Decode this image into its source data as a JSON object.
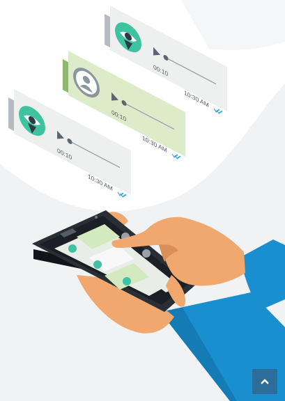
{
  "voice_messages": [
    {
      "kind": "eye",
      "duration": "00:10",
      "time": "10:30 AM",
      "status": "read"
    },
    {
      "kind": "avatar",
      "duration": "00:10",
      "time": "10:30 AM",
      "status": "read"
    },
    {
      "kind": "eye",
      "duration": "00:10",
      "time": "10:30 AM",
      "status": "read"
    }
  ],
  "colors": {
    "card_grey": "#ebeded",
    "card_green": "#dcebc8",
    "accent_teal": "#3fc2a0",
    "sleeve_blue": "#1a8fd0",
    "skin": "#f0a86e",
    "scroll_button": "#2c6e99"
  },
  "icons": {
    "scroll_top": "chevron-up-icon"
  }
}
